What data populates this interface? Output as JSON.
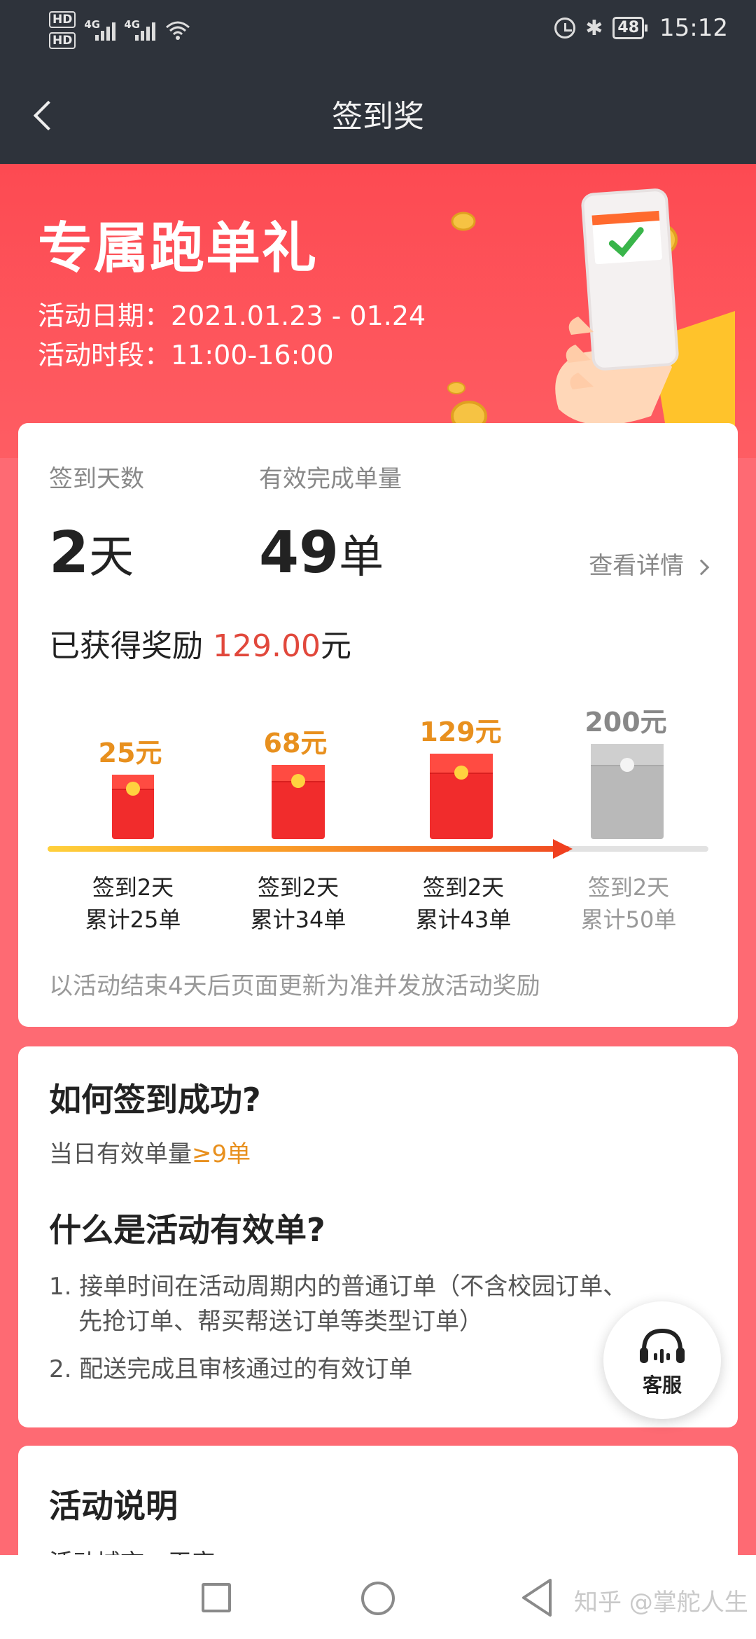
{
  "status_bar": {
    "hd1": "HD",
    "hd2": "HD",
    "net1": "4G",
    "net2": "4G",
    "battery": "48",
    "time": "15:12"
  },
  "nav": {
    "title": "签到奖"
  },
  "hero": {
    "title": "专属跑单礼",
    "date_line": "活动日期：2021.01.23 - 01.24",
    "time_line": "活动时段：11:00-16:00"
  },
  "summary": {
    "days_label": "签到天数",
    "days_value": "2",
    "days_unit": "天",
    "orders_label": "有效完成单量",
    "orders_value": "49",
    "orders_unit": "单",
    "detail_link": "查看详情",
    "reward_prefix": "已获得奖励",
    "reward_amount": "129.00",
    "reward_unit": "元"
  },
  "tiers": [
    {
      "amount": "25元",
      "cond1": "签到2天",
      "cond2": "累计25单",
      "achieved": true
    },
    {
      "amount": "68元",
      "cond1": "签到2天",
      "cond2": "累计34单",
      "achieved": true
    },
    {
      "amount": "129元",
      "cond1": "签到2天",
      "cond2": "累计43单",
      "achieved": true
    },
    {
      "amount": "200元",
      "cond1": "签到2天",
      "cond2": "累计50单",
      "achieved": false
    }
  ],
  "progress_fraction": 0.79,
  "note": "以活动结束4天后页面更新为准并发放活动奖励",
  "howto": {
    "title": "如何签到成功?",
    "text_prefix": "当日有效单量",
    "text_highlight": "≥9单",
    "valid_title": "什么是活动有效单?",
    "item1_line1": "1. 接单时间在活动周期内的普通订单（不含校园订单、",
    "item1_line2": "先抢订单、帮买帮送订单等类型订单）",
    "item2": "2. 配送完成且审核通过的有效订单"
  },
  "service": {
    "label": "客服"
  },
  "rules": {
    "title": "活动说明",
    "first_line": "活动城市：平定"
  },
  "watermark": "知乎 @掌舵人生",
  "colors": {
    "hero_red": "#fd4a52",
    "amount_orange": "#e8901e",
    "reward_red": "#e1483c",
    "navbar": "#2e333b"
  }
}
